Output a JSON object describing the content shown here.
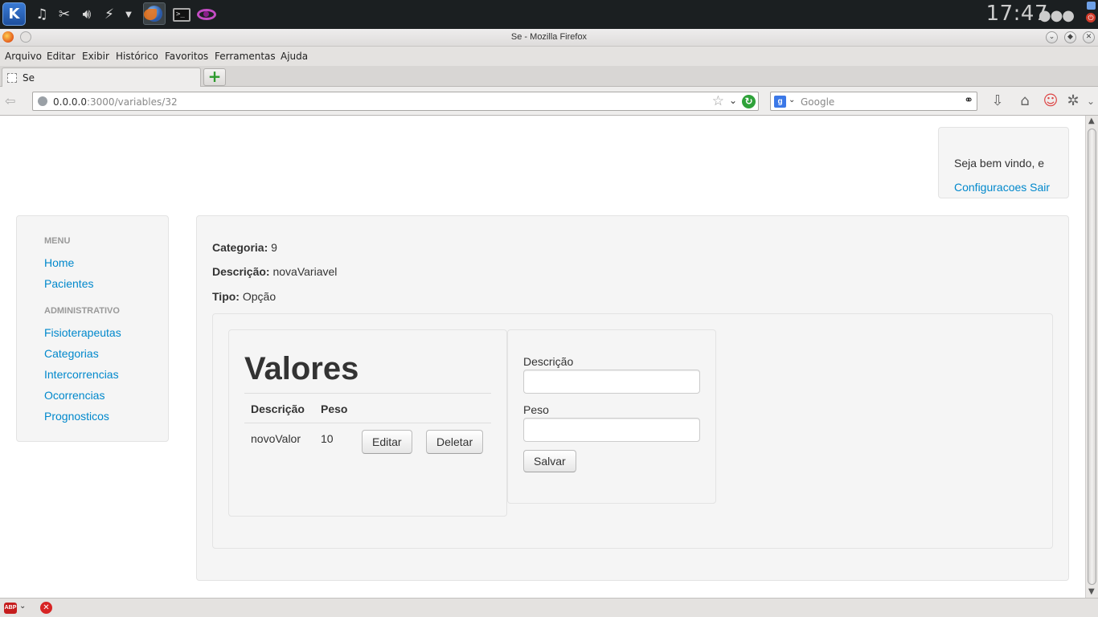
{
  "taskbar": {
    "clock": "17:47",
    "dots": "●●●",
    "launcher_glyph": "K",
    "icons": [
      "kde-menu-icon",
      "music-icon",
      "tools-icon",
      "volume-icon",
      "network-icon",
      "chevron-down-icon",
      "firefox-icon",
      "terminal-icon",
      "eye-icon"
    ]
  },
  "window": {
    "title": "Se - Mozilla Firefox"
  },
  "menubar": {
    "items": [
      "Arquivo",
      "Editar",
      "Exibir",
      "Histórico",
      "Favoritos",
      "Ferramentas",
      "Ajuda"
    ]
  },
  "tabs": {
    "active_label": "Se",
    "new_tab": "+"
  },
  "navbar": {
    "url_host": "0.0.0.0",
    "url_rest": ":3000/variables/32",
    "search_placeholder": "Google",
    "search_engine_letter": "g"
  },
  "header": {
    "welcome": "Seja bem vindo, e",
    "settings_link": "Configuracoes",
    "logout_link": "Sair"
  },
  "sidebar": {
    "header_menu": "MENU",
    "menu_items": [
      "Home",
      "Pacientes"
    ],
    "header_admin": "ADMINISTRATIVO",
    "admin_items": [
      "Fisioterapeutas",
      "Categorias",
      "Intercorrencias",
      "Ocorrencias",
      "Prognosticos"
    ]
  },
  "variable": {
    "categoria_label": "Categoria:",
    "categoria_value": "9",
    "descricao_label": "Descrição:",
    "descricao_value": "novaVariavel",
    "tipo_label": "Tipo:",
    "tipo_value": "Opção"
  },
  "valores": {
    "title": "Valores",
    "columns": [
      "Descrição",
      "Peso"
    ],
    "rows": [
      {
        "descricao": "novoValor",
        "peso": "10",
        "edit_label": "Editar",
        "delete_label": "Deletar"
      }
    ]
  },
  "form": {
    "descricao_label": "Descrição",
    "descricao_value": "",
    "peso_label": "Peso",
    "peso_value": "",
    "submit_label": "Salvar"
  },
  "colors": {
    "link": "#0088cc",
    "well_bg": "#f5f5f5",
    "text": "#333333"
  }
}
